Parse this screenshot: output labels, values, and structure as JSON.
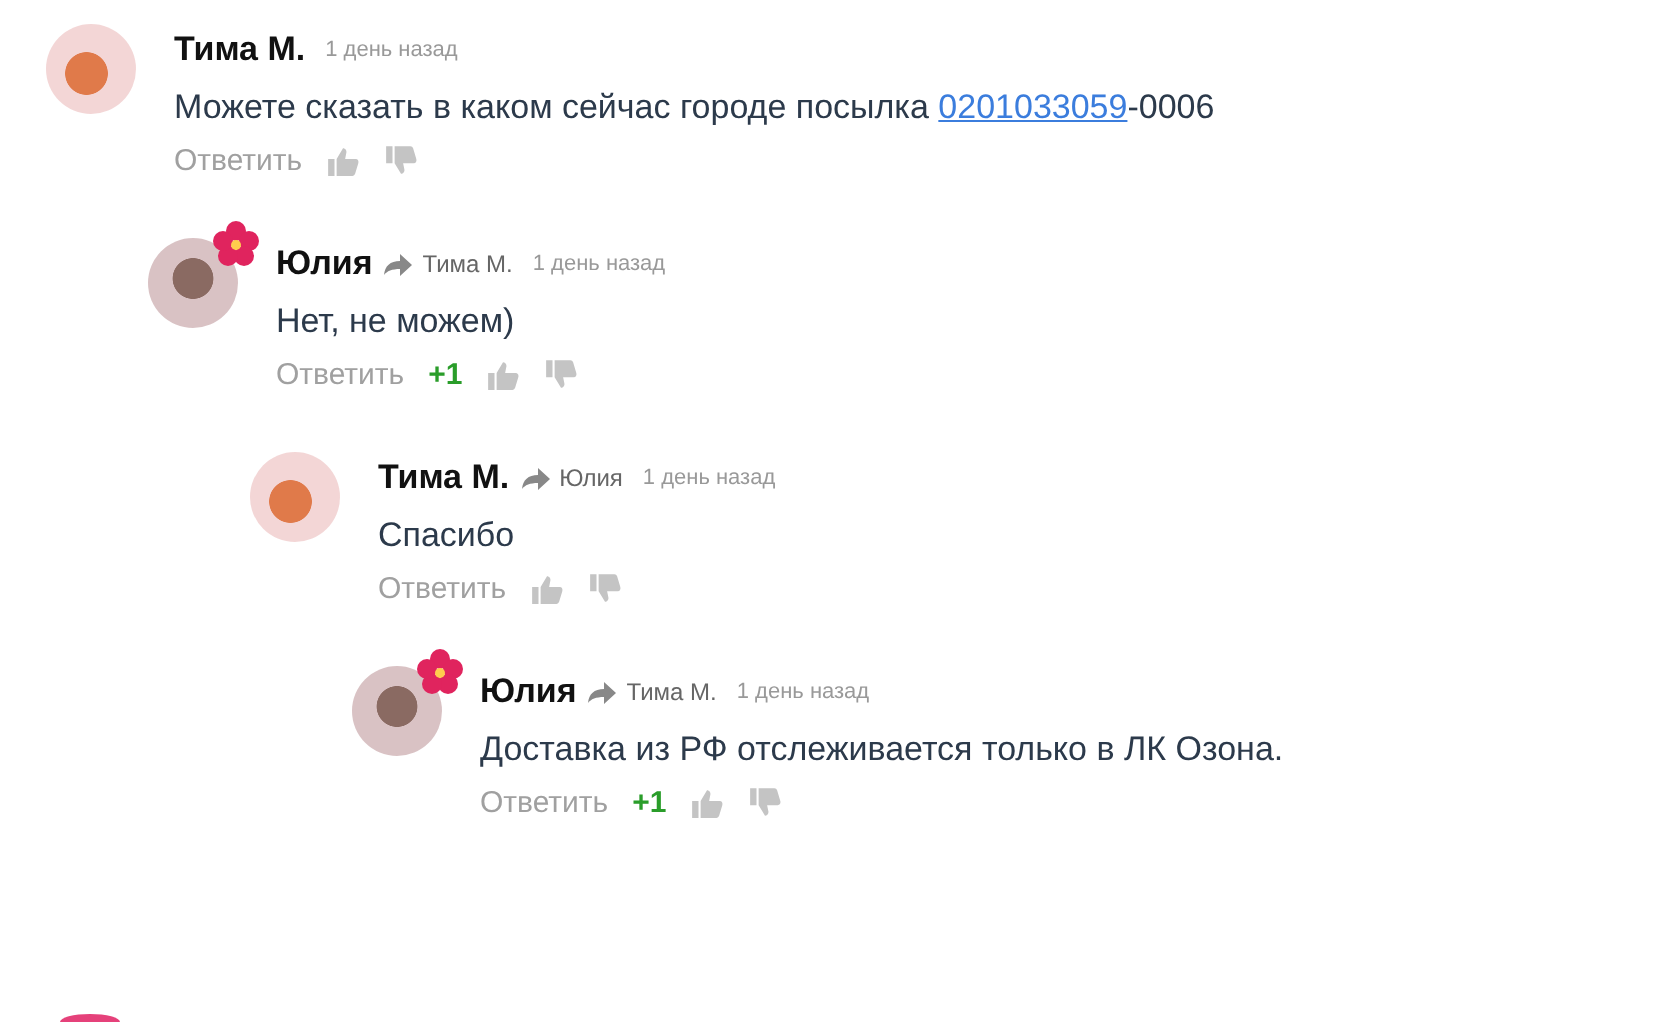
{
  "comments": [
    {
      "author": "Тима М.",
      "has_badge": false,
      "time": "1 день назад",
      "text": [
        {
          "link": false,
          "text": "Можете сказать в каком сейчас городе посылка "
        },
        {
          "link": true,
          "text": "0201033059"
        },
        {
          "link": false,
          "text": "-0006"
        }
      ],
      "reply_label": "Ответить",
      "children": [
        {
          "author": "Юлия",
          "has_badge": true,
          "reply_to": "Тима М.",
          "time": "1 день назад",
          "text": [
            {
              "link": false,
              "text": "Нет, не можем)"
            }
          ],
          "reply_label": "Ответить",
          "score": "+1",
          "children": [
            {
              "author": "Тима М.",
              "has_badge": false,
              "reply_to": "Юлия",
              "time": "1 день назад",
              "text": [
                {
                  "link": false,
                  "text": "Спасибо"
                }
              ],
              "reply_label": "Ответить",
              "children": [
                {
                  "author": "Юлия",
                  "has_badge": true,
                  "reply_to": "Тима М.",
                  "time": "1 день назад",
                  "text": [
                    {
                      "link": false,
                      "text": "Доставка из РФ отслеживается только в ЛК Озона."
                    }
                  ],
                  "reply_label": "Ответить",
                  "score": "+1"
                }
              ]
            }
          ]
        }
      ]
    }
  ],
  "more_below": true
}
